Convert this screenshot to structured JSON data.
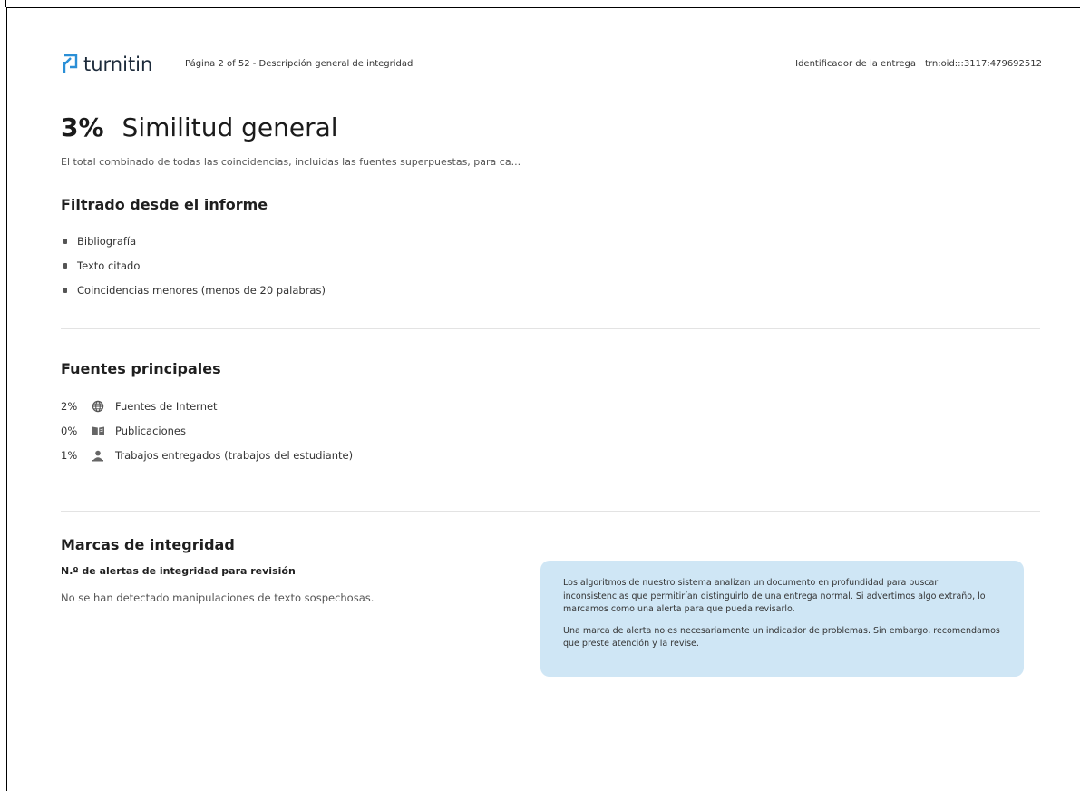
{
  "header": {
    "logo_text": "turnitin",
    "page_info": "Página 2 of 52 - Descripción general de integridad",
    "submission_label": "Identificador de la entrega",
    "submission_id": "trn:oid:::3117:479692512"
  },
  "similarity": {
    "percent": "3%",
    "title": "Similitud general",
    "description": "El total combinado de todas las coincidencias, incluidas las fuentes superpuestas, para ca..."
  },
  "filtered": {
    "heading": "Filtrado desde el informe",
    "items": [
      "Bibliografía",
      "Texto citado",
      "Coincidencias menores (menos de 20 palabras)"
    ]
  },
  "sources": {
    "heading": "Fuentes principales",
    "items": [
      {
        "percent": "2%",
        "icon": "globe-icon",
        "label": "Fuentes de Internet"
      },
      {
        "percent": "0%",
        "icon": "book-icon",
        "label": "Publicaciones"
      },
      {
        "percent": "1%",
        "icon": "person-icon",
        "label": "Trabajos entregados (trabajos del estudiante)"
      }
    ]
  },
  "integrity": {
    "heading": "Marcas de integridad",
    "subheading": "N.º de alertas de integridad para revisión",
    "status": "No se han detectado manipulaciones de texto sospechosas.",
    "info_paragraphs": [
      "Los algoritmos de nuestro sistema analizan un documento en profundidad para buscar inconsistencias que permitirían distinguirlo de una entrega normal. Si advertimos algo extraño, lo marcamos como una alerta para que pueda revisarlo.",
      "Una marca de alerta no es necesariamente un indicador de problemas. Sin embargo, recomendamos que preste atención y la revise."
    ]
  },
  "colors": {
    "logo_accent": "#2b8fd6",
    "info_box_bg": "#cfe6f5",
    "divider": "#e3e3e3"
  }
}
